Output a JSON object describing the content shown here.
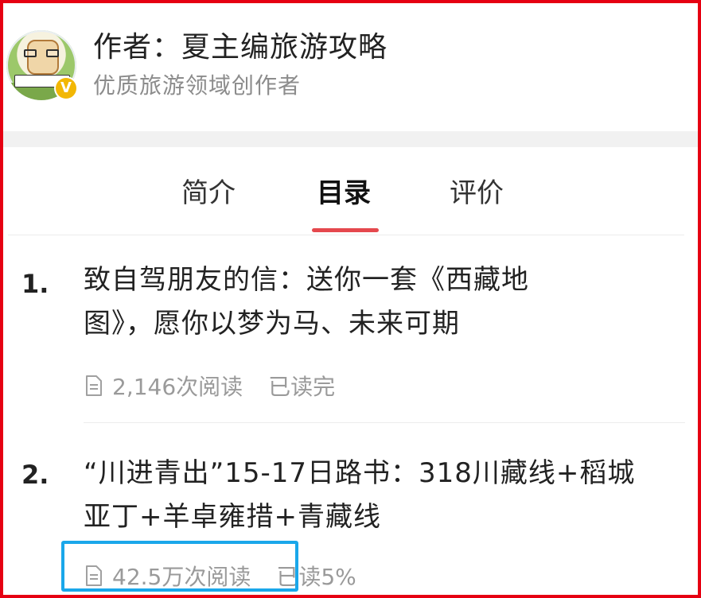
{
  "header": {
    "author": "作者：夏主编旅游攻略",
    "subtitle": "优质旅游领域创作者",
    "avatar_icon": "avatar-icon",
    "verified_badge": "V"
  },
  "tabs": [
    {
      "label": "简介",
      "active": false
    },
    {
      "label": "目录",
      "active": true
    },
    {
      "label": "评价",
      "active": false
    }
  ],
  "colors": {
    "outer_border": "#e60012",
    "tab_indicator": "#e5484d",
    "highlight_box": "#1aa7ea"
  },
  "items": [
    {
      "number": "1.",
      "title_line1": "致自驾朋友的信：送你一套《西藏地",
      "title_line2": "图》，愿你以梦为马、未来可期",
      "reads": "2,146次阅读",
      "status": "已读完",
      "icon": "document-icon"
    },
    {
      "number": "2.",
      "title_line1": "“川进青出”15-17日路书：318川藏线+稻城",
      "title_line2": "亚丁+羊卓雍措+青藏线",
      "reads": "42.5万次阅读",
      "status": "已读5%",
      "icon": "document-icon"
    }
  ]
}
